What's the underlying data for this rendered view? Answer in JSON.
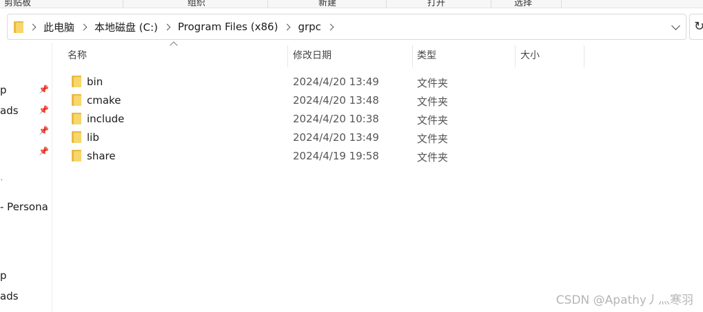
{
  "ribbon": {
    "groups": [
      "剪贴板",
      "组织",
      "新建",
      "打开",
      "选择"
    ]
  },
  "breadcrumb": {
    "items": [
      "此电脑",
      "本地磁盘 (C:)",
      "Program Files (x86)",
      "grpc"
    ]
  },
  "sidebar": {
    "items": [
      "p",
      "ads",
      "",
      "",
      "",
      "- Persona",
      "p",
      "ads"
    ]
  },
  "columns": {
    "name": "名称",
    "date": "修改日期",
    "type": "类型",
    "size": "大小"
  },
  "files": [
    {
      "name": "bin",
      "date": "2024/4/20 13:49",
      "type": "文件夹"
    },
    {
      "name": "cmake",
      "date": "2024/4/20 13:48",
      "type": "文件夹"
    },
    {
      "name": "include",
      "date": "2024/4/20 10:38",
      "type": "文件夹"
    },
    {
      "name": "lib",
      "date": "2024/4/20 13:49",
      "type": "文件夹"
    },
    {
      "name": "share",
      "date": "2024/4/19 19:58",
      "type": "文件夹"
    }
  ],
  "watermark": "CSDN @Apathy丿灬寒羽",
  "icons": {
    "folder": "folder-icon",
    "pin": "pin-icon",
    "chevron": "chevron-right-icon",
    "refresh": "refresh-icon"
  },
  "colors": {
    "folder_back": "#e8b93f",
    "folder_front": "#f7d66a"
  }
}
